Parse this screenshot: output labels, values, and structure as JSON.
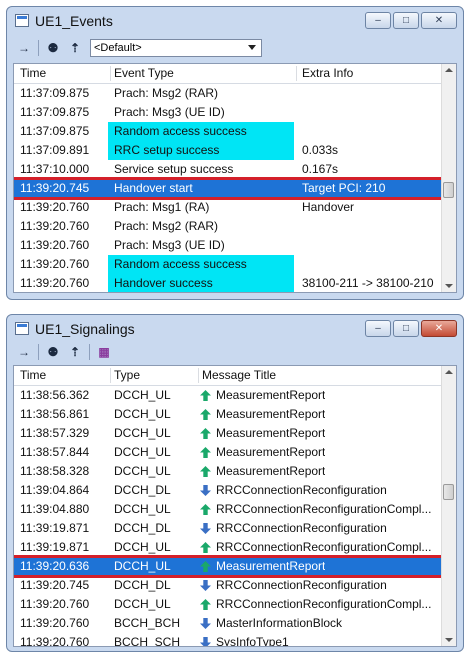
{
  "events_window": {
    "title": "UE1_Events",
    "filter_value": "<Default>",
    "columns": [
      "Time",
      "Event Type",
      "Extra Info"
    ],
    "rows": [
      {
        "time": "11:37:09.875",
        "event": "Prach: Msg2 (RAR)",
        "extra": "",
        "highlight": false
      },
      {
        "time": "11:37:09.875",
        "event": "Prach: Msg3 (UE ID)",
        "extra": "",
        "highlight": false
      },
      {
        "time": "11:37:09.875",
        "event": "Random access success",
        "extra": "",
        "highlight": true
      },
      {
        "time": "11:37:09.891",
        "event": "RRC setup success",
        "extra": "0.033s",
        "highlight": true
      },
      {
        "time": "11:37:10.000",
        "event": "Service setup success",
        "extra": "0.167s",
        "highlight": false
      },
      {
        "time": "11:39:20.745",
        "event": "Handover start",
        "extra": "Target PCI: 210",
        "highlight": false,
        "selected": true
      },
      {
        "time": "11:39:20.760",
        "event": "Prach: Msg1 (RA)",
        "extra": "Handover",
        "highlight": false
      },
      {
        "time": "11:39:20.760",
        "event": "Prach: Msg2 (RAR)",
        "extra": "",
        "highlight": false
      },
      {
        "time": "11:39:20.760",
        "event": "Prach: Msg3 (UE ID)",
        "extra": "",
        "highlight": false
      },
      {
        "time": "11:39:20.760",
        "event": "Random access success",
        "extra": "",
        "highlight": true
      },
      {
        "time": "11:39:20.760",
        "event": "Handover success",
        "extra": "38100-211 -> 38100-210",
        "highlight": true
      }
    ]
  },
  "signalings_window": {
    "title": "UE1_Signalings",
    "columns": [
      "Time",
      "Type",
      "Message Title"
    ],
    "rows": [
      {
        "time": "11:38:56.362",
        "type": "DCCH_UL",
        "dir": "up",
        "title": "MeasurementReport"
      },
      {
        "time": "11:38:56.861",
        "type": "DCCH_UL",
        "dir": "up",
        "title": "MeasurementReport"
      },
      {
        "time": "11:38:57.329",
        "type": "DCCH_UL",
        "dir": "up",
        "title": "MeasurementReport"
      },
      {
        "time": "11:38:57.844",
        "type": "DCCH_UL",
        "dir": "up",
        "title": "MeasurementReport"
      },
      {
        "time": "11:38:58.328",
        "type": "DCCH_UL",
        "dir": "up",
        "title": "MeasurementReport"
      },
      {
        "time": "11:39:04.864",
        "type": "DCCH_DL",
        "dir": "down",
        "title": "RRCConnectionReconfiguration"
      },
      {
        "time": "11:39:04.880",
        "type": "DCCH_UL",
        "dir": "up",
        "title": "RRCConnectionReconfigurationCompl..."
      },
      {
        "time": "11:39:19.871",
        "type": "DCCH_DL",
        "dir": "down",
        "title": "RRCConnectionReconfiguration"
      },
      {
        "time": "11:39:19.871",
        "type": "DCCH_UL",
        "dir": "up",
        "title": "RRCConnectionReconfigurationCompl..."
      },
      {
        "time": "11:39:20.636",
        "type": "DCCH_UL",
        "dir": "up",
        "title": "MeasurementReport",
        "selected": true
      },
      {
        "time": "11:39:20.745",
        "type": "DCCH_DL",
        "dir": "down",
        "title": "RRCConnectionReconfiguration"
      },
      {
        "time": "11:39:20.760",
        "type": "DCCH_UL",
        "dir": "up",
        "title": "RRCConnectionReconfigurationCompl..."
      },
      {
        "time": "11:39:20.760",
        "type": "BCCH_BCH",
        "dir": "down",
        "title": "MasterInformationBlock"
      },
      {
        "time": "11:39:20.760",
        "type": "BCCH_SCH",
        "dir": "down",
        "title": "SysInfoType1"
      }
    ]
  },
  "colors": {
    "highlight": "#00e5f5",
    "selection": "#1e73d6",
    "callout": "#d4202a",
    "arrow_up": "#1aa86a",
    "arrow_down": "#3a6fc4"
  },
  "icons": [
    "pin-icon",
    "find-icon",
    "find-next-icon",
    "color-legend-icon",
    "minimize-icon",
    "maximize-icon",
    "close-icon"
  ]
}
